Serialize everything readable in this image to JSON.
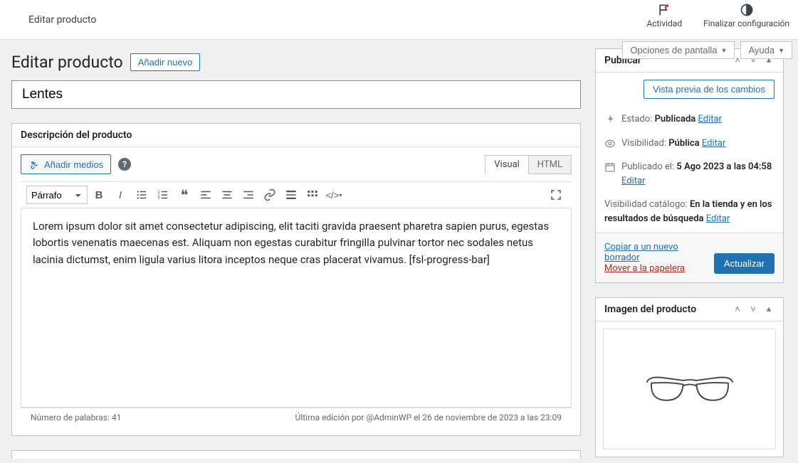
{
  "topbar": {
    "breadcrumb": "Editar producto",
    "activity": "Actividad",
    "finish": "Finalizar configuración"
  },
  "options": {
    "screen": "Opciones de pantalla",
    "help": "Ayuda"
  },
  "heading": {
    "title": "Editar producto",
    "add_new": "Añadir nuevo"
  },
  "product": {
    "title": "Lentes"
  },
  "editor": {
    "box_title": "Descripción del producto",
    "add_media": "Añadir medios",
    "tab_visual": "Visual",
    "tab_html": "HTML",
    "format": "Párrafo",
    "content": "Lorem ipsum dolor sit amet consectetur adipiscing, elit taciti gravida praesent pharetra sapien purus, egestas lobortis venenatis maecenas est. Aliquam non egestas curabitur fringilla pulvinar tortor nec sodales netus lacinia dictumst, enim ligula varius litora inceptos neque cras placerat vivamus. [fsl-progress-bar]",
    "word_count": "Número de palabras: 41",
    "last_edit": "Última edición por @AdminWP el 26 de noviembre de 2023 a las 23:09"
  },
  "publish": {
    "box_title": "Publicar",
    "preview": "Vista previa de los cambios",
    "status_lbl": "Estado:",
    "status_val": "Publicada",
    "edit": "Editar",
    "vis_lbl": "Visibilidad:",
    "vis_val": "Pública",
    "date_lbl": "Publicado el:",
    "date_val": "5 Ago 2023 a las 04:58",
    "catalog_lbl": "Visibilidad catálogo:",
    "catalog_val": "En la tienda y en los resultados de búsqueda",
    "copy": "Copiar a un nuevo borrador",
    "trash": "Mover a la papelera",
    "update": "Actualizar"
  },
  "image": {
    "box_title": "Imagen del producto"
  }
}
